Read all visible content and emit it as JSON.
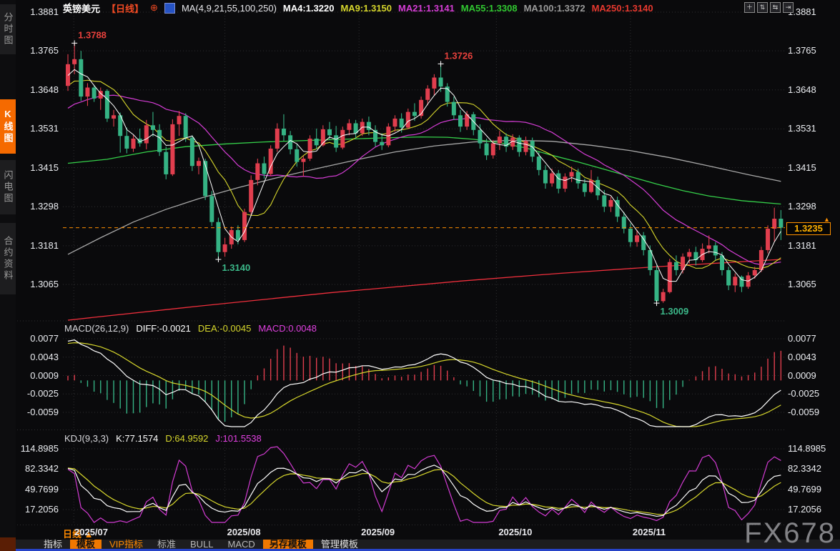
{
  "header": {
    "symbol": "英镑美元",
    "period_tag": "【日线】",
    "plus_icon": "⊕",
    "ma_settings": "MA(4,9,21,55,100,250)",
    "ma_values": [
      {
        "label": "MA4:1.3220",
        "color": "#ffffff"
      },
      {
        "label": "MA9:1.3150",
        "color": "#d7d72c"
      },
      {
        "label": "MA21:1.3141",
        "color": "#d53dd5"
      },
      {
        "label": "MA55:1.3308",
        "color": "#31c931"
      },
      {
        "label": "MA100:1.3372",
        "color": "#9a9a9a"
      },
      {
        "label": "MA250:1.3140",
        "color": "#e8392f"
      }
    ]
  },
  "toolbar": {
    "icons": [
      {
        "name": "crosshair-icon",
        "glyph": "＋"
      },
      {
        "name": "y-scale-icon",
        "glyph": "⇅"
      },
      {
        "name": "x-scale-icon",
        "glyph": "⇆"
      },
      {
        "name": "pan-right-icon",
        "glyph": "⇥"
      }
    ]
  },
  "sidebar": {
    "items": [
      {
        "label": "分时图",
        "active": false
      },
      {
        "label": "K线图",
        "active": true
      },
      {
        "label": "闪电图",
        "active": false
      },
      {
        "label": "合约资料",
        "active": false
      }
    ]
  },
  "macd_panel": {
    "title": "MACD(26,12,9)",
    "diff_label": "DIFF:-0.0021",
    "dea_label": "DEA:-0.0045",
    "macd_label": "MACD:0.0048"
  },
  "kdj_panel": {
    "title": "KDJ(9,3,3)",
    "k_label": "K:77.1574",
    "d_label": "D:64.9592",
    "j_label": "J:101.5538"
  },
  "price_tag": {
    "value": "1.3235",
    "arrow": "▲"
  },
  "time_axis": {
    "period_label": "日线 ▲"
  },
  "bottom_tabs": [
    {
      "label": "指标",
      "style": "plain"
    },
    {
      "label": "模板",
      "style": "orangebg"
    },
    {
      "label": "VIP指标",
      "style": "orangetx"
    },
    {
      "label": "标准",
      "style": "dim"
    },
    {
      "label": "BULL",
      "style": "dim"
    },
    {
      "label": "MACD",
      "style": "dim"
    },
    {
      "label": "另存模板",
      "style": "orangebg"
    },
    {
      "label": "管理模板",
      "style": "plain"
    }
  ],
  "watermark": "FX678",
  "chart_data": {
    "type": "candlestick+indicators",
    "symbol": "GBP/USD daily",
    "current_price": 1.3235,
    "main_axis": {
      "labels": [
        "1.3881",
        "1.3765",
        "1.3648",
        "1.3531",
        "1.3415",
        "1.3298",
        "1.3181",
        "1.3065"
      ],
      "prices": [
        1.3881,
        1.3765,
        1.3648,
        1.3531,
        1.3415,
        1.3298,
        1.3181,
        1.3065
      ]
    },
    "macd_axis": {
      "labels": [
        "0.0077",
        "0.0043",
        "0.0009",
        "-0.0025",
        "-0.0059"
      ],
      "values": [
        0.0077,
        0.0043,
        0.0009,
        -0.0025,
        -0.0059
      ]
    },
    "kdj_axis": {
      "labels": [
        "114.8985",
        "82.3342",
        "49.7699",
        "17.2056"
      ],
      "values": [
        114.8985,
        82.3342,
        49.7699,
        17.2056
      ]
    },
    "months": [
      {
        "label": "2025/07",
        "index": 0.9
      },
      {
        "label": "2025/08",
        "index": 24
      },
      {
        "label": "2025/09",
        "index": 44.5
      },
      {
        "label": "2025/10",
        "index": 65.5
      },
      {
        "label": "2025/11",
        "index": 86
      }
    ],
    "annotations": [
      {
        "text": "1.3788",
        "index": 1,
        "price": 1.3788,
        "placement": "above",
        "color": "#e8413c"
      },
      {
        "text": "1.3726",
        "index": 57,
        "price": 1.3726,
        "placement": "above",
        "color": "#e8413c"
      },
      {
        "text": "1.3140",
        "index": 23,
        "price": 1.314,
        "placement": "below",
        "color": "#3cb98a"
      },
      {
        "text": "1.3009",
        "index": 90,
        "price": 1.3009,
        "placement": "below",
        "color": "#3cb98a"
      }
    ],
    "overlays": {
      "ma55": [
        [
          0,
          1.3428
        ],
        [
          6,
          1.344
        ],
        [
          12,
          1.3462
        ],
        [
          18,
          1.3478
        ],
        [
          24,
          1.3486
        ],
        [
          30,
          1.3492
        ],
        [
          36,
          1.3496
        ],
        [
          42,
          1.35
        ],
        [
          48,
          1.3504
        ],
        [
          54,
          1.3507
        ],
        [
          58,
          1.3506
        ],
        [
          62,
          1.35
        ],
        [
          66,
          1.349
        ],
        [
          70,
          1.3474
        ],
        [
          74,
          1.3452
        ],
        [
          78,
          1.3432
        ],
        [
          82,
          1.341
        ],
        [
          86,
          1.3388
        ],
        [
          90,
          1.3366
        ],
        [
          94,
          1.3346
        ],
        [
          98,
          1.333
        ],
        [
          103,
          1.3316
        ],
        [
          109,
          1.3306
        ]
      ],
      "ma100": [
        [
          0,
          1.3155
        ],
        [
          5,
          1.3205
        ],
        [
          10,
          1.3252
        ],
        [
          15,
          1.329
        ],
        [
          20,
          1.3322
        ],
        [
          26,
          1.3355
        ],
        [
          32,
          1.3385
        ],
        [
          38,
          1.3412
        ],
        [
          44,
          1.3438
        ],
        [
          50,
          1.3462
        ],
        [
          56,
          1.348
        ],
        [
          62,
          1.3492
        ],
        [
          68,
          1.3497
        ],
        [
          74,
          1.3494
        ],
        [
          80,
          1.3482
        ],
        [
          86,
          1.3466
        ],
        [
          92,
          1.3445
        ],
        [
          98,
          1.342
        ],
        [
          104,
          1.3394
        ],
        [
          109,
          1.3374
        ]
      ],
      "ma250": [
        [
          0,
          1.2958
        ],
        [
          20,
          1.3
        ],
        [
          40,
          1.304
        ],
        [
          60,
          1.3075
        ],
        [
          75,
          1.3098
        ],
        [
          90,
          1.3118
        ],
        [
          109,
          1.314
        ]
      ]
    },
    "candles": [
      [
        1.366,
        1.3755,
        1.3645,
        1.3725
      ],
      [
        1.3725,
        1.3788,
        1.3695,
        1.374
      ],
      [
        1.374,
        1.3765,
        1.3615,
        1.3628
      ],
      [
        1.3628,
        1.3668,
        1.36,
        1.3655
      ],
      [
        1.3655,
        1.3662,
        1.3612,
        1.3622
      ],
      [
        1.3622,
        1.3655,
        1.3588,
        1.3645
      ],
      [
        1.3645,
        1.365,
        1.3552,
        1.3562
      ],
      [
        1.3562,
        1.3588,
        1.3538,
        1.3572
      ],
      [
        1.3572,
        1.358,
        1.346,
        1.351
      ],
      [
        1.351,
        1.3535,
        1.3458,
        1.3472
      ],
      [
        1.3472,
        1.3512,
        1.3462,
        1.3502
      ],
      [
        1.3502,
        1.3532,
        1.3478,
        1.3488
      ],
      [
        1.3488,
        1.3558,
        1.347,
        1.3542
      ],
      [
        1.3542,
        1.3582,
        1.3508,
        1.3528
      ],
      [
        1.3528,
        1.3545,
        1.345,
        1.3462
      ],
      [
        1.3462,
        1.3478,
        1.338,
        1.3395
      ],
      [
        1.3395,
        1.356,
        1.339,
        1.3545
      ],
      [
        1.3545,
        1.3585,
        1.351,
        1.357
      ],
      [
        1.357,
        1.3578,
        1.3492,
        1.3505
      ],
      [
        1.3505,
        1.3512,
        1.3405,
        1.342
      ],
      [
        1.342,
        1.3445,
        1.3395,
        1.3435
      ],
      [
        1.3435,
        1.3442,
        1.3318,
        1.333
      ],
      [
        1.333,
        1.3345,
        1.324,
        1.3252
      ],
      [
        1.3252,
        1.3265,
        1.314,
        1.3162
      ],
      [
        1.3162,
        1.3205,
        1.3148,
        1.3185
      ],
      [
        1.3185,
        1.3238,
        1.3172,
        1.3228
      ],
      [
        1.3228,
        1.3242,
        1.3185,
        1.3198
      ],
      [
        1.3198,
        1.3292,
        1.3192,
        1.3282
      ],
      [
        1.3282,
        1.3392,
        1.3272,
        1.3378
      ],
      [
        1.3378,
        1.3442,
        1.3362,
        1.3428
      ],
      [
        1.3428,
        1.3448,
        1.3382,
        1.3396
      ],
      [
        1.3396,
        1.3482,
        1.339,
        1.3472
      ],
      [
        1.3472,
        1.3548,
        1.3462,
        1.3532
      ],
      [
        1.3532,
        1.3575,
        1.3495,
        1.3512
      ],
      [
        1.3512,
        1.3525,
        1.3455,
        1.347
      ],
      [
        1.347,
        1.3485,
        1.3418,
        1.3432
      ],
      [
        1.3432,
        1.345,
        1.3388,
        1.3442
      ],
      [
        1.3442,
        1.3512,
        1.3435,
        1.3502
      ],
      [
        1.3502,
        1.3532,
        1.347,
        1.3482
      ],
      [
        1.3482,
        1.3542,
        1.3478,
        1.353
      ],
      [
        1.353,
        1.3552,
        1.3498,
        1.3512
      ],
      [
        1.3512,
        1.354,
        1.3462,
        1.3475
      ],
      [
        1.3475,
        1.3538,
        1.347,
        1.3528
      ],
      [
        1.3528,
        1.356,
        1.3512,
        1.3548
      ],
      [
        1.3548,
        1.3558,
        1.3502,
        1.3518
      ],
      [
        1.3518,
        1.3562,
        1.351,
        1.3552
      ],
      [
        1.3552,
        1.3568,
        1.3512,
        1.3528
      ],
      [
        1.3528,
        1.3542,
        1.3478,
        1.3492
      ],
      [
        1.3492,
        1.3518,
        1.3468,
        1.3482
      ],
      [
        1.3482,
        1.3548,
        1.3476,
        1.3538
      ],
      [
        1.3538,
        1.3572,
        1.3522,
        1.3562
      ],
      [
        1.3562,
        1.3578,
        1.352,
        1.3535
      ],
      [
        1.3535,
        1.3592,
        1.353,
        1.3582
      ],
      [
        1.3582,
        1.3608,
        1.3555,
        1.357
      ],
      [
        1.357,
        1.3628,
        1.3562,
        1.3618
      ],
      [
        1.3618,
        1.3662,
        1.3602,
        1.3652
      ],
      [
        1.3652,
        1.3695,
        1.3632,
        1.3685
      ],
      [
        1.3685,
        1.3726,
        1.3642,
        1.3658
      ],
      [
        1.3658,
        1.3668,
        1.3598,
        1.3612
      ],
      [
        1.3612,
        1.3628,
        1.3558,
        1.3572
      ],
      [
        1.3572,
        1.3588,
        1.3522,
        1.3538
      ],
      [
        1.3538,
        1.3585,
        1.3528,
        1.3575
      ],
      [
        1.3575,
        1.3582,
        1.3512,
        1.3528
      ],
      [
        1.3528,
        1.3545,
        1.3472,
        1.3488
      ],
      [
        1.3488,
        1.3502,
        1.3438,
        1.3452
      ],
      [
        1.3452,
        1.3498,
        1.3442,
        1.3488
      ],
      [
        1.3488,
        1.3525,
        1.3468,
        1.3508
      ],
      [
        1.3508,
        1.3518,
        1.3462,
        1.3478
      ],
      [
        1.3478,
        1.3515,
        1.3468,
        1.3505
      ],
      [
        1.3505,
        1.3512,
        1.3448,
        1.3462
      ],
      [
        1.3462,
        1.3508,
        1.3452,
        1.3495
      ],
      [
        1.3495,
        1.3505,
        1.3432,
        1.3448
      ],
      [
        1.3448,
        1.3462,
        1.3392,
        1.3408
      ],
      [
        1.3408,
        1.3422,
        1.3352,
        1.3368
      ],
      [
        1.3368,
        1.3412,
        1.3358,
        1.3398
      ],
      [
        1.3398,
        1.3408,
        1.3338,
        1.3352
      ],
      [
        1.3352,
        1.3398,
        1.3342,
        1.3388
      ],
      [
        1.3388,
        1.3418,
        1.3372,
        1.3402
      ],
      [
        1.3402,
        1.3412,
        1.3352,
        1.3368
      ],
      [
        1.3368,
        1.3382,
        1.3328,
        1.3342
      ],
      [
        1.3342,
        1.3408,
        1.3338,
        1.3378
      ],
      [
        1.3378,
        1.3388,
        1.3318,
        1.3332
      ],
      [
        1.3332,
        1.3348,
        1.3282,
        1.3298
      ],
      [
        1.3298,
        1.3328,
        1.3282,
        1.3318
      ],
      [
        1.3318,
        1.3328,
        1.3252,
        1.3268
      ],
      [
        1.3268,
        1.3282,
        1.3218,
        1.3232
      ],
      [
        1.3232,
        1.3248,
        1.3178,
        1.3192
      ],
      [
        1.3192,
        1.3228,
        1.3178,
        1.3212
      ],
      [
        1.3212,
        1.3222,
        1.3152,
        1.3168
      ],
      [
        1.3168,
        1.3182,
        1.3092,
        1.3108
      ],
      [
        1.3108,
        1.3122,
        1.3009,
        1.3015
      ],
      [
        1.3015,
        1.3052,
        1.301,
        1.3042
      ],
      [
        1.3042,
        1.3142,
        1.3038,
        1.3132
      ],
      [
        1.3132,
        1.3152,
        1.3092,
        1.3108
      ],
      [
        1.3108,
        1.3158,
        1.3098,
        1.3148
      ],
      [
        1.3148,
        1.3172,
        1.3128,
        1.3162
      ],
      [
        1.3162,
        1.3178,
        1.3122,
        1.3138
      ],
      [
        1.3138,
        1.3188,
        1.3132,
        1.3172
      ],
      [
        1.3172,
        1.3212,
        1.3158,
        1.3182
      ],
      [
        1.3182,
        1.3192,
        1.3138,
        1.3152
      ],
      [
        1.3152,
        1.3162,
        1.3092,
        1.3108
      ],
      [
        1.3108,
        1.3118,
        1.3048,
        1.3062
      ],
      [
        1.3062,
        1.3098,
        1.3042,
        1.3088
      ],
      [
        1.3088,
        1.3092,
        1.3042,
        1.3058
      ],
      [
        1.3058,
        1.3102,
        1.3052,
        1.3092
      ],
      [
        1.3092,
        1.3118,
        1.3082,
        1.3108
      ],
      [
        1.3108,
        1.3178,
        1.3102,
        1.3168
      ],
      [
        1.3168,
        1.3242,
        1.3158,
        1.3232
      ],
      [
        1.3232,
        1.3295,
        1.3192,
        1.3262
      ],
      [
        1.3262,
        1.3288,
        1.3198,
        1.3235
      ]
    ],
    "colors": {
      "up": "#e13e4e",
      "down": "#35b384",
      "ma4": "#ffffff",
      "ma9": "#d7d72c",
      "ma21": "#d53dd5",
      "ma55": "#35d04a",
      "ma100": "#a8a8a8",
      "ma250": "#ef2f3c",
      "kdj_k": "#ffffff",
      "kdj_d": "#d7d72c",
      "kdj_j": "#d23bd2",
      "price_line": "#ff8f00",
      "grid": "#2e2e30"
    }
  }
}
